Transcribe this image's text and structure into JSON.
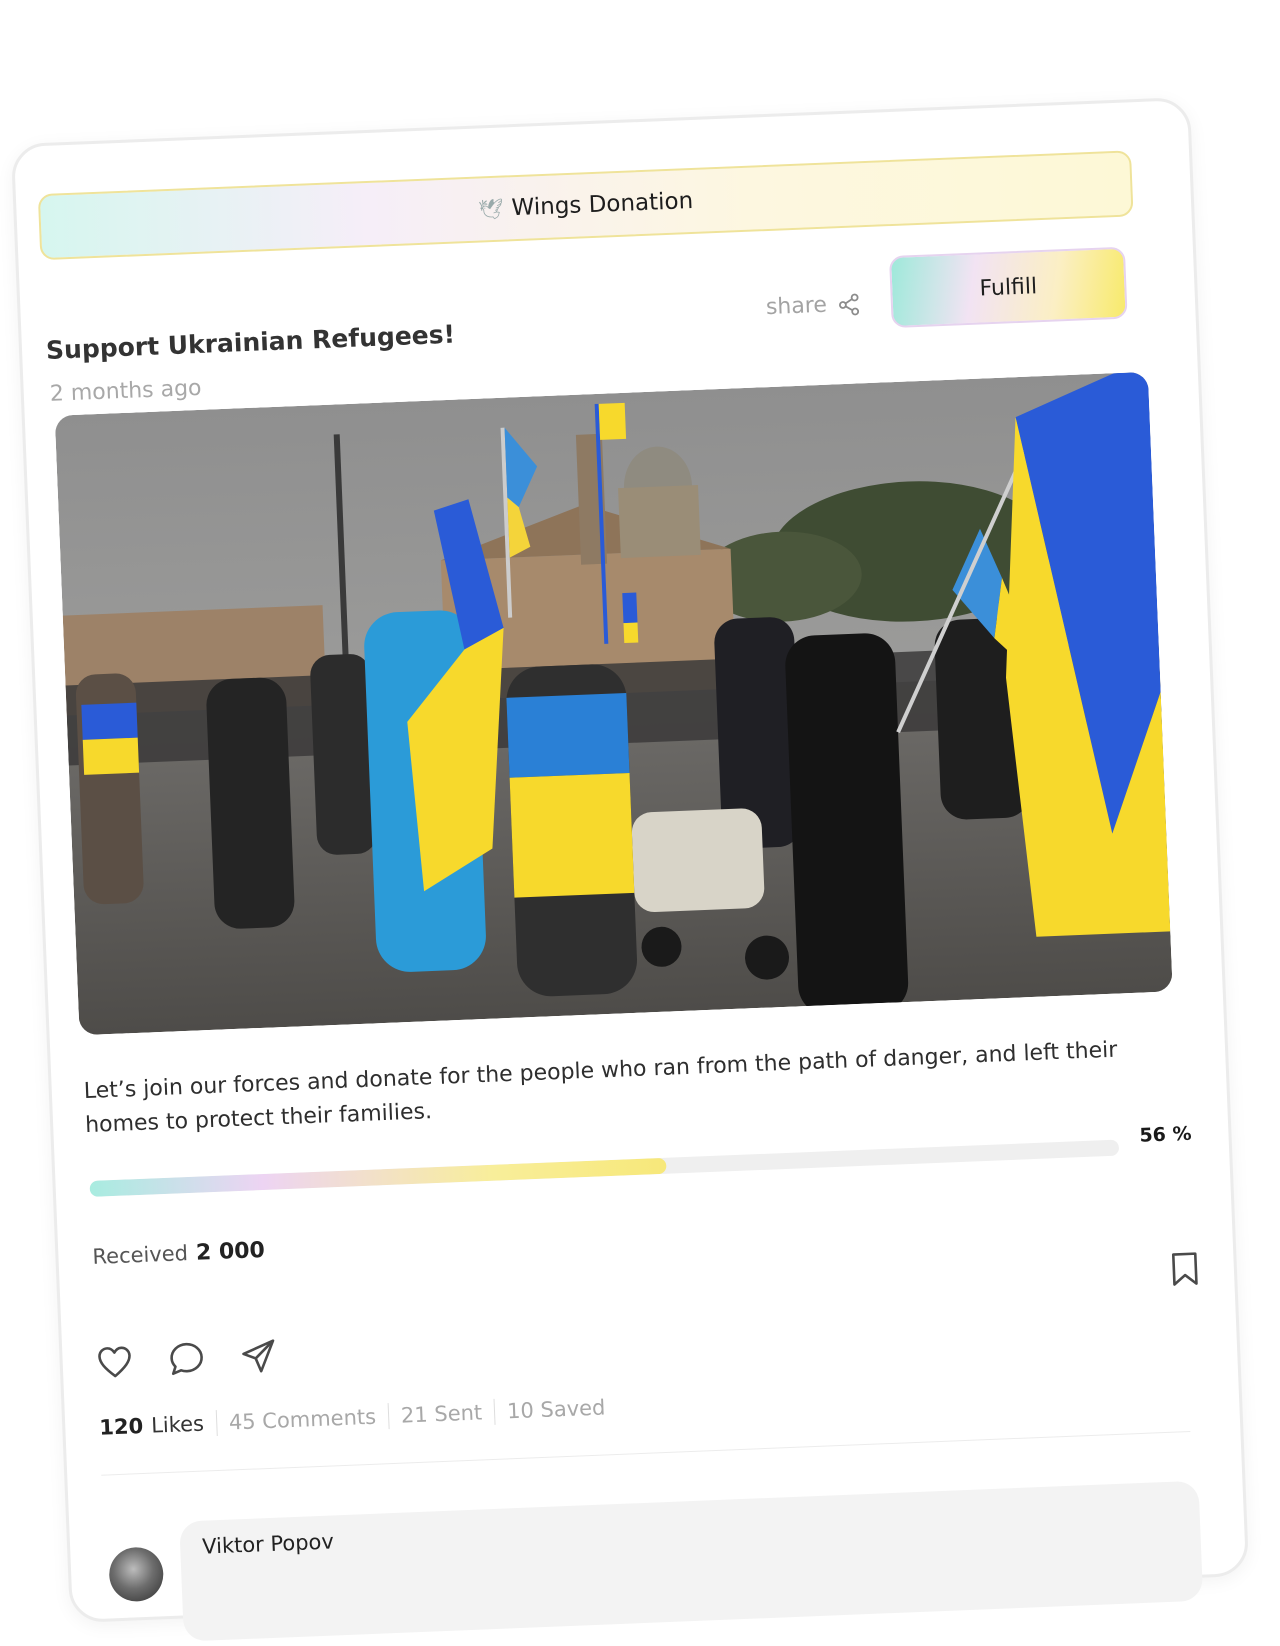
{
  "banner": {
    "label": "Wings Donation"
  },
  "post": {
    "title": "Support Ukrainian Refugees!",
    "time_ago": "2 months ago",
    "share_label": "share",
    "fulfill_label": "Fulfill",
    "description": "Let’s join our forces and donate for the people who ran from the path of danger, and left their homes to protect their families."
  },
  "progress": {
    "percent_value": 56,
    "percent_label": "56 %"
  },
  "received": {
    "label": "Received",
    "amount": "2 000"
  },
  "stats": {
    "likes_count": "120",
    "likes_label": "Likes",
    "comments": "45 Comments",
    "sent": "21 Sent",
    "saved": "10 Saved"
  },
  "comment": {
    "author": "Viktor Popov"
  },
  "colors": {
    "ukraine_blue": "#2a5bd7",
    "ukraine_yellow": "#f7d92c",
    "accent_mint": "#9ee9da",
    "accent_yellow": "#f8ea6b"
  },
  "icons": [
    "dove-icon",
    "share-icon",
    "heart-icon",
    "comment-icon",
    "send-icon",
    "bookmark-icon"
  ]
}
